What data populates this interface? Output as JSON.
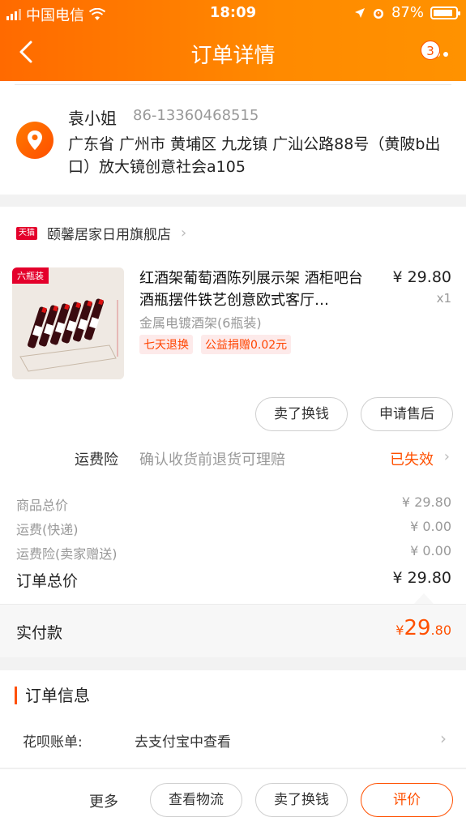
{
  "status_bar": {
    "carrier": "中国电信",
    "time": "18:09",
    "battery": "87%",
    "battery_level": 0.87
  },
  "nav": {
    "title": "订单详情",
    "badge": "3"
  },
  "address": {
    "name": "袁小姐",
    "phone": "86-13360468515",
    "address": "广东省 广州市 黄埔区 九龙镇 广汕公路88号（黄陂b出口）放大镜创意社会a105"
  },
  "store": {
    "badge": "天猫",
    "name": "颐馨居家日用旗舰店",
    "product": {
      "image_tag": "六瓶装",
      "title": "红酒架葡萄酒陈列展示架 酒柜吧台酒瓶摆件铁艺创意欧式客厅…",
      "price": "¥ 29.80",
      "qty": "x1",
      "sku": "金属电镀酒架(6瓶装)",
      "tags": [
        "七天退换",
        "公益捐赠0.02元"
      ]
    },
    "actions": {
      "sell": "卖了换钱",
      "after_sale": "申请售后"
    },
    "insurance": {
      "label": "运费险",
      "desc": "确认收货前退货可理赔",
      "status": "已失效"
    }
  },
  "summary": {
    "goods_label": "商品总价",
    "goods_value": "¥ 29.80",
    "shipping_label": "运费(快递)",
    "shipping_value": "¥ 0.00",
    "ins_label": "运费险(卖家赠送)",
    "ins_value": "¥ 0.00",
    "total_label": "订单总价",
    "total_value": "¥ 29.80",
    "paid_label": "实付款",
    "paid_currency": "¥",
    "paid_int": "29",
    "paid_dec": ".80"
  },
  "order_info": {
    "title": "订单信息",
    "key": "花呗账单:",
    "value": "去支付宝中查看"
  },
  "bottom_bar": {
    "more": "更多",
    "logistics": "查看物流",
    "sell": "卖了换钱",
    "review": "评价"
  },
  "colors": {
    "accent": "#ff5000",
    "header_start": "#ff6a00",
    "header_end": "#ff9200",
    "tmall": "#e4002b"
  }
}
